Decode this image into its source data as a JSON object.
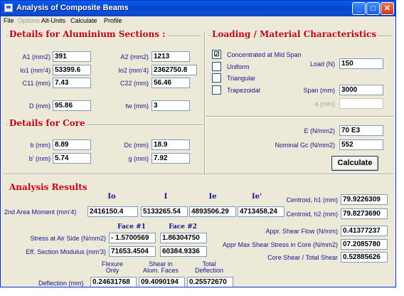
{
  "window": {
    "title": "Analysis of Composite Beams",
    "controls": {
      "minimize": "_",
      "maximize": "□",
      "close": "✕"
    }
  },
  "menu": {
    "items": [
      {
        "label": "File",
        "enabled": true
      },
      {
        "label": "Options",
        "enabled": false
      },
      {
        "label": "Alt-Units",
        "enabled": true
      },
      {
        "label": "Calculate",
        "enabled": true
      },
      {
        "label": "Profile",
        "enabled": true
      }
    ]
  },
  "aluminium": {
    "title": "Details for Aluminium Sections :",
    "a1_label": "A1 (mm2)",
    "a1_value": "391",
    "a2_label": "A2 (mm2)",
    "a2_value": "1213",
    "io1_label": "Io1 (mm'4)",
    "io1_value": "53399.6",
    "io2_label": "Io2 (mm'4)",
    "io2_value": "2362750.8",
    "c11_label": "C11 (mm)",
    "c11_value": "7.43",
    "c22_label": "C22 (mm)",
    "c22_value": "56.46",
    "d_label": "D (mm)",
    "d_value": "95.86",
    "tw_label": "tw (mm)",
    "tw_value": "3"
  },
  "core": {
    "title": "Details for Core",
    "b_label": "b (mm)",
    "b_value": "8.89",
    "dc_label": "Dc (mm)",
    "dc_value": "18.9",
    "bp_label": "b' (mm)",
    "bp_value": "5.74",
    "g_label": "g (mm)",
    "g_value": "7.92"
  },
  "loading": {
    "title": "Loading / Material Characteristics",
    "options": [
      {
        "label": "Concentrated at Mid Span",
        "checked": true
      },
      {
        "label": "Uniform",
        "checked": false
      },
      {
        "label": "Triangular",
        "checked": false
      },
      {
        "label": "Trapezoidal",
        "checked": false
      }
    ],
    "load_label": "Load (N)",
    "load_value": "150",
    "span_label": "Span (mm)",
    "span_value": "3000",
    "a_label": "a (mm)",
    "a_value": "",
    "e_label": "E (N/mm2)",
    "e_value": "70 E3",
    "gc_label": "Nominal Gc (N/mm2)",
    "gc_value": "552",
    "calculate_label": "Calculate"
  },
  "results": {
    "title": "Analysis Results",
    "col_heads": [
      "Io",
      "I",
      "Ie",
      "Ie'"
    ],
    "moment_label": "2nd Area Moment (mm'4)",
    "moment_values": [
      "2416150.4",
      "5133265.54",
      "4893506.29",
      "4713458.24"
    ],
    "face_heads": [
      "Face #1",
      "Face #2"
    ],
    "stress_label": "Stress at Air Side (N/mm2)",
    "stress_values": [
      "- 1.5700569",
      "1.86304750"
    ],
    "modulus_label": "Eff. Section Modulus (mm'3)",
    "modulus_values": [
      "71653.4504",
      "60384.9336"
    ],
    "deflection_heads": [
      "Flexure\nOnly",
      "Shear in\nAlum. Faces",
      "Total\nDeflection"
    ],
    "deflection_label": "Deflection (mm)",
    "deflection_values": [
      "0.24631768",
      "09.4090194",
      "0.25572670"
    ],
    "centroid1_label": "Centroid, h1 (mm)",
    "centroid1_value": "79.9226309",
    "centroid2_label": "Centroid, h2 (mm)",
    "centroid2_value": "79.8273690",
    "shear_flow_label": "Appr. Shear Flow (N/mm)",
    "shear_flow_value": "0.41377237",
    "max_shear_label": "Appr Max Shear Stress in Core (N/mm2)",
    "max_shear_value": "07.2085780",
    "core_shear_label": "Core Shear / Total Shear",
    "core_shear_value": "0.52885626"
  }
}
